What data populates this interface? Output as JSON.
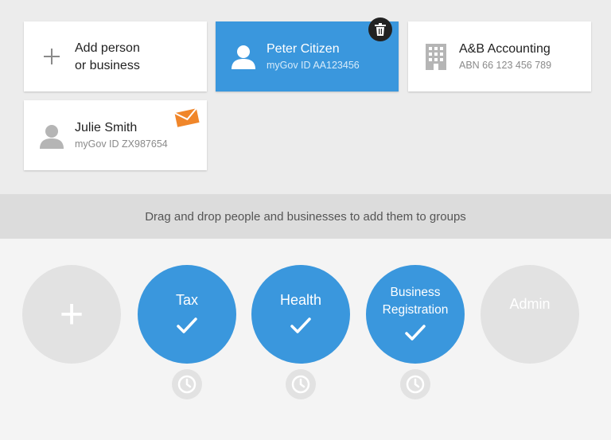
{
  "cards": [
    {
      "name_line1": "Add person",
      "name_line2": "or business",
      "icon": "plus-icon"
    },
    {
      "name": "Peter Citizen",
      "sub": "myGov ID AA123456",
      "icon": "person-icon",
      "selected": true,
      "badge": "trash-icon"
    },
    {
      "name": "A&B Accounting",
      "sub": "ABN 66 123 456 789",
      "icon": "building-icon"
    },
    {
      "name": "Julie Smith",
      "sub": "myGov ID ZX987654",
      "icon": "person-icon",
      "badge": "envelope-icon"
    }
  ],
  "banner": {
    "text": "Drag and drop people and businesses to add them to groups"
  },
  "groups": [
    {
      "label": "+",
      "kind": "add"
    },
    {
      "label": "Tax",
      "active": true,
      "has_check": true
    },
    {
      "label": "Health",
      "active": true,
      "has_check": true
    },
    {
      "label_line1": "Business",
      "label_line2": "Registration",
      "active": true,
      "has_check": true
    },
    {
      "label": "Admin",
      "active": false
    }
  ],
  "colors": {
    "accent": "#3a97dd",
    "badge_orange": "#f0862a",
    "inactive": "#e2e2e2"
  }
}
